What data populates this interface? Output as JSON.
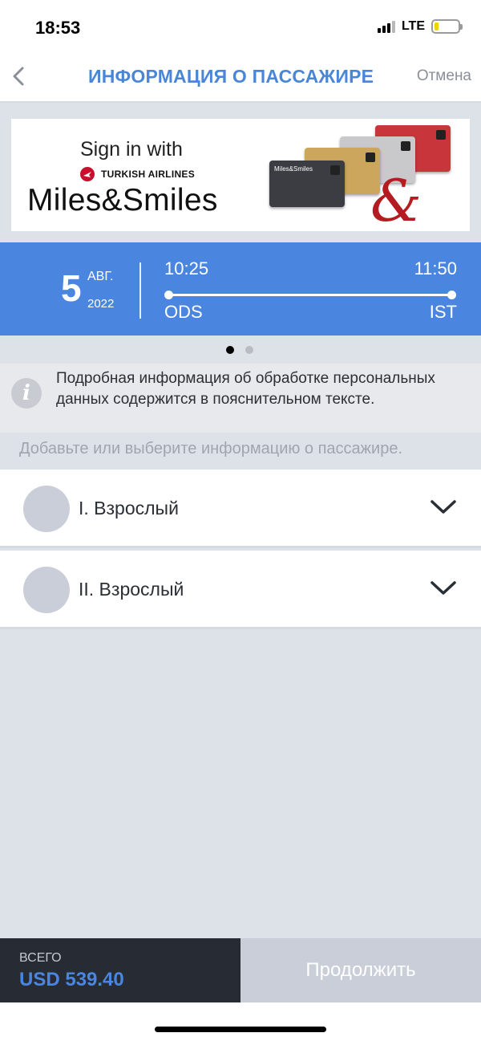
{
  "status_bar": {
    "time": "18:53",
    "network": "LTE"
  },
  "header": {
    "title": "ИНФОРМАЦИЯ О ПАССАЖИРЕ",
    "cancel_label": "Отмена",
    "accent_color": "#4a86d8"
  },
  "banner": {
    "sign_in_text": "Sign in with",
    "airline": "TURKISH AIRLINES",
    "program": "Miles&Smiles",
    "card_label": "Miles&Smiles",
    "ampersand": "&"
  },
  "flight": {
    "day": "5",
    "month": "АВГ.",
    "year": "2022",
    "departure_time": "10:25",
    "arrival_time": "11:50",
    "departure_code": "ODS",
    "arrival_code": "IST",
    "bar_color": "#4a86e0"
  },
  "pager": {
    "count": 2,
    "active_index": 0
  },
  "info": {
    "icon": "info-icon",
    "text": "Подробная информация об обработке персональных данных содержится в пояснительном тексте."
  },
  "hint": "Добавьте или выберите информацию о пассажире.",
  "passengers": [
    {
      "label": "I. Взрослый"
    },
    {
      "label": "II. Взрослый"
    }
  ],
  "footer": {
    "total_label": "ВСЕГО",
    "total_amount": "USD 539.40",
    "continue_label": "Продолжить"
  }
}
